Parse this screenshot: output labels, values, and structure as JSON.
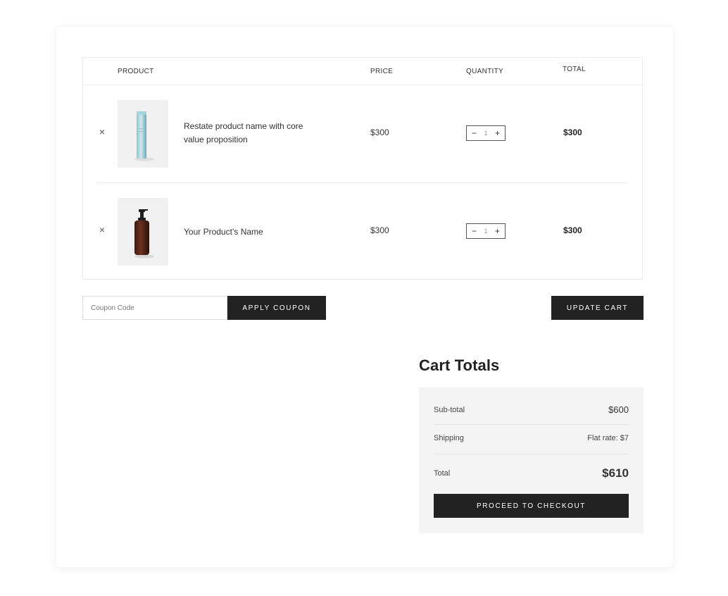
{
  "table": {
    "headers": {
      "product": "PRODUCT",
      "price": "PRICE",
      "quantity": "QUANTITY",
      "total": "TOTAL"
    },
    "rows": [
      {
        "remove_icon": "×",
        "name": "Restate product name with core value proposition",
        "price": "$300",
        "qty_minus": "−",
        "qty": "1",
        "qty_plus": "+",
        "total": "$300",
        "image": "blue-tube-bottle"
      },
      {
        "remove_icon": "×",
        "name": "Your Product’s Name",
        "price": "$300",
        "qty_minus": "−",
        "qty": "1",
        "qty_plus": "+",
        "total": "$300",
        "image": "amber-pump-bottle"
      }
    ]
  },
  "coupon": {
    "placeholder": "Coupon Code",
    "apply_label": "APPLY COUPON"
  },
  "update_label": "UPDATE CART",
  "totals": {
    "title": "Cart Totals",
    "subtotal_label": "Sub-total",
    "subtotal_value": "$600",
    "shipping_label": "Shipping",
    "shipping_value": "Flat rate: $7",
    "total_label": "Total",
    "total_value": "$610",
    "checkout_label": "PROCEED TO CHECKOUT"
  },
  "colors": {
    "dark_button": "#222222",
    "totals_background": "#f4f4f4",
    "border": "#ebebeb"
  }
}
